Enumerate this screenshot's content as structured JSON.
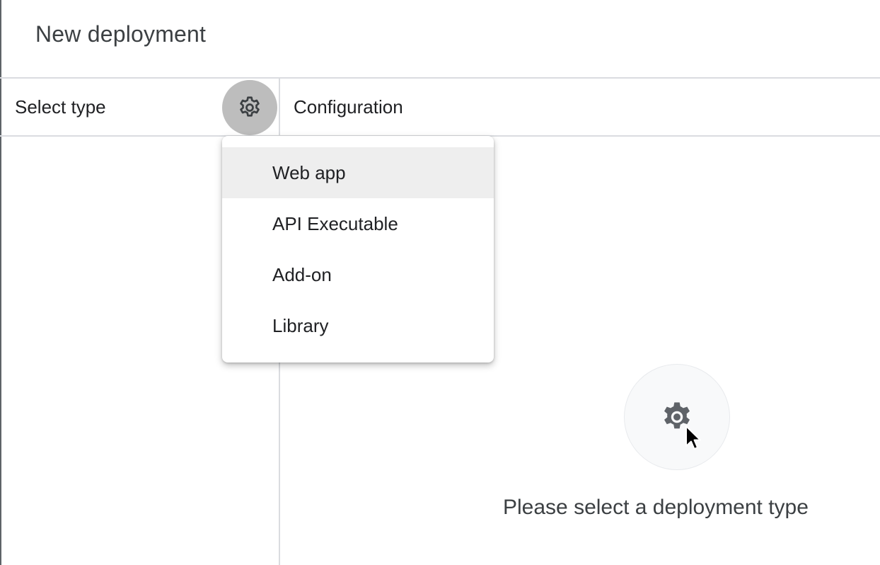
{
  "dialog": {
    "title": "New deployment"
  },
  "left_panel": {
    "header": "Select type",
    "gear_icon": "gear-icon"
  },
  "right_panel": {
    "header": "Configuration",
    "empty_state_icon": "gear-icon",
    "empty_state_message": "Please select a deployment type"
  },
  "type_menu": {
    "items": [
      {
        "label": "Web app"
      },
      {
        "label": "API Executable"
      },
      {
        "label": "Add-on"
      },
      {
        "label": "Library"
      }
    ]
  },
  "colors": {
    "divider": "#dadce0",
    "gear_button_bg": "#bdbdbd",
    "menu_highlight": "#eeeeee",
    "text_primary": "#202124",
    "text_secondary": "#3c4043"
  }
}
